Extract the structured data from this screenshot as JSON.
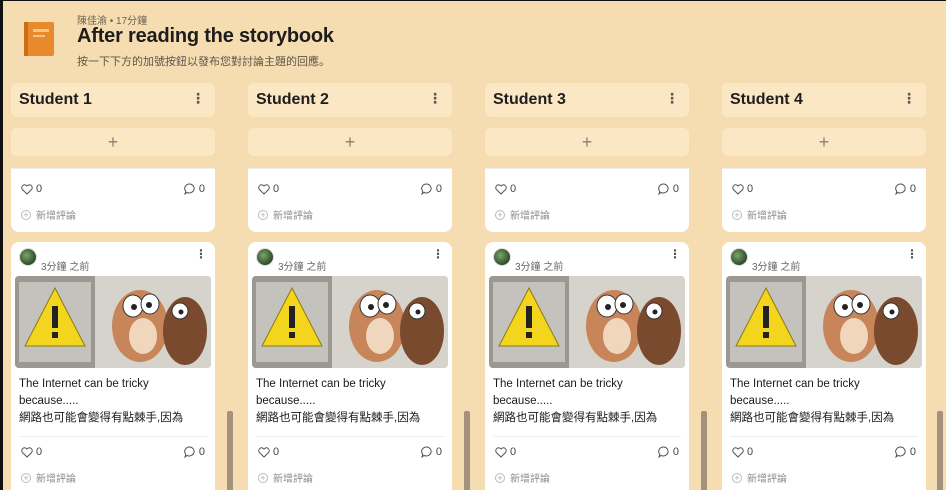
{
  "header": {
    "meta": "陳佳渝 • 17分鐘",
    "title": "After reading the storybook",
    "subtitle": "按一下下方的加號按鈕以發布您對討論主題的回應。"
  },
  "columns": [
    {
      "title": "Student 1",
      "stub": {
        "likes": "0",
        "comments": "0",
        "add_comment": "新增評論"
      },
      "post": {
        "time": "3分鐘 之前",
        "line1": "The Internet can be tricky",
        "line2": "because.....",
        "line3": "網路也可能會變得有點棘手,因為",
        "likes": "0",
        "comments": "0",
        "add_comment": "新增評論"
      }
    },
    {
      "title": "Student 2",
      "stub": {
        "likes": "0",
        "comments": "0",
        "add_comment": "新增評論"
      },
      "post": {
        "time": "3分鐘 之前",
        "line1": "The Internet can be tricky",
        "line2": "because.....",
        "line3": "網路也可能會變得有點棘手,因為",
        "likes": "0",
        "comments": "0",
        "add_comment": "新增評論"
      }
    },
    {
      "title": "Student 3",
      "stub": {
        "likes": "0",
        "comments": "0",
        "add_comment": "新增評論"
      },
      "post": {
        "time": "3分鐘 之前",
        "line1": "The Internet can be tricky",
        "line2": "because.....",
        "line3": "網路也可能會變得有點棘手,因為",
        "likes": "0",
        "comments": "0",
        "add_comment": "新增評論"
      }
    },
    {
      "title": "Student 4",
      "stub": {
        "likes": "0",
        "comments": "0",
        "add_comment": "新增評論"
      },
      "post": {
        "time": "3分鐘 之前",
        "line1": "The Internet can be tricky",
        "line2": "because.....",
        "line3": "網路也可能會變得有點棘手,因為",
        "likes": "0",
        "comments": "0",
        "add_comment": "新增評論"
      }
    }
  ],
  "icons": {
    "add": "+",
    "kebab": "⋮"
  },
  "colors": {
    "background": "#f6ddb1",
    "column_header": "#fbe7c4",
    "book": "#e8892b"
  }
}
